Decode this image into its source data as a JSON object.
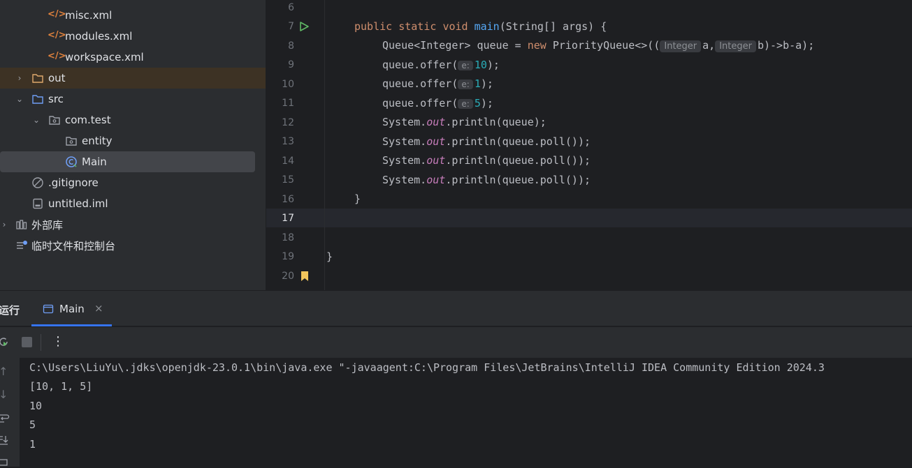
{
  "project_tree": {
    "items": [
      {
        "label": "misc.xml",
        "icon": "xml-file-icon"
      },
      {
        "label": "modules.xml",
        "icon": "xml-file-icon"
      },
      {
        "label": "workspace.xml",
        "icon": "xml-file-icon"
      },
      {
        "label": "out",
        "icon": "folder-icon"
      },
      {
        "label": "src",
        "icon": "source-folder-icon"
      },
      {
        "label": "com.test",
        "icon": "package-icon"
      },
      {
        "label": "entity",
        "icon": "package-icon"
      },
      {
        "label": "Main",
        "icon": "java-class-icon"
      },
      {
        "label": ".gitignore",
        "icon": "ignore-file-icon"
      },
      {
        "label": "untitled.iml",
        "icon": "module-file-icon"
      },
      {
        "label": "外部库",
        "icon": "libraries-icon"
      },
      {
        "label": "临时文件和控制台",
        "icon": "scratches-icon"
      }
    ]
  },
  "editor": {
    "line_numbers": [
      "6",
      "7",
      "8",
      "9",
      "10",
      "11",
      "12",
      "13",
      "14",
      "15",
      "16",
      "17",
      "18",
      "19",
      "20"
    ],
    "current_line": "17",
    "code": {
      "l7_public": "public",
      "l7_static": "static",
      "l7_void": "void",
      "l7_main": "main",
      "l7_rest": "(String[] args) {",
      "l8_a": "Queue<Integer> queue = ",
      "l8_new": "new",
      "l8_b": " PriorityQueue<>((",
      "l8_hint1": "Integer",
      "l8_c": "a,",
      "l8_hint2": "Integer",
      "l8_d": "b)->b-a);",
      "offer_prefix": "queue.offer(",
      "offer_hint": "e:",
      "offer_values": [
        "10",
        "1",
        "5"
      ],
      "offer_suffix": ");",
      "sys": "System.",
      "out": "out",
      "println_queue": ".println(queue);",
      "println_poll": ".println(queue.poll());",
      "close_method": "}",
      "close_class": "}"
    }
  },
  "run_panel": {
    "title": "运行",
    "tab_label": "Main",
    "console_lines": [
      "C:\\Users\\LiuYu\\.jdks\\openjdk-23.0.1\\bin\\java.exe \"-javaagent:C:\\Program Files\\JetBrains\\IntelliJ IDEA Community Edition 2024.3",
      "[10, 1, 5]",
      "10",
      "5",
      "1"
    ]
  }
}
